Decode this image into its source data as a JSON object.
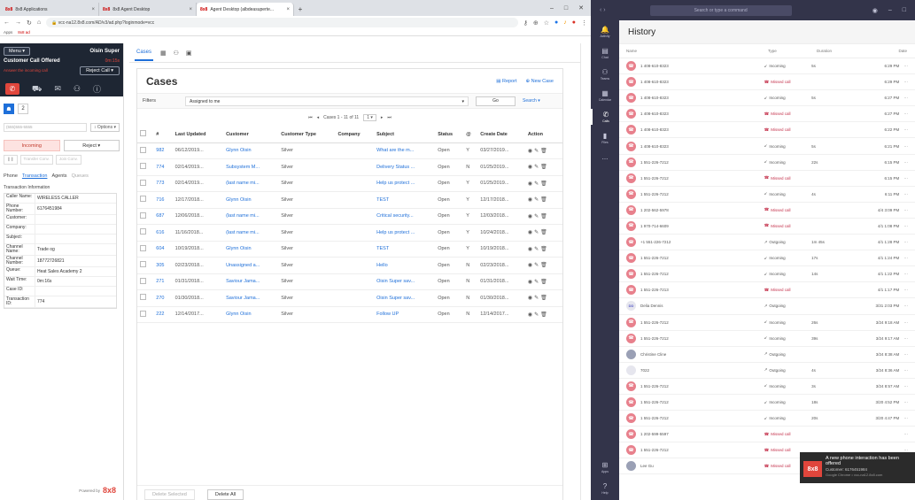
{
  "browser": {
    "tabs": [
      {
        "label": "8x8 Applications",
        "fav": "8x8"
      },
      {
        "label": "8x8 Agent Desktop",
        "fav": "8x8"
      },
      {
        "label": "Agent Desktop (albdeasuperte... ",
        "fav": "8x8"
      }
    ],
    "url": "vcc-na12.8x8.com/AD/v3/ad.php?loginmode=vcc",
    "bookmarks": [
      "Apps",
      "8x8 ad"
    ],
    "win_controls": [
      "–",
      "□",
      "✕"
    ]
  },
  "agent": {
    "menu_label": "Menu",
    "agent_name": "Oisin Super",
    "status": "Customer Call Offered",
    "timer": "0m:15s",
    "warning": "Answer the incoming call",
    "reject_call_label": "Reject Call",
    "search_placeholder": "(555)555-5555",
    "options_label": "Options",
    "incoming_label": "Incoming",
    "reject_label": "Reject",
    "call_ops": [
      "Transfer Conv.",
      "Join Conv."
    ],
    "tabs": [
      "Phone",
      "Transaction",
      "Agents",
      "Queues"
    ],
    "info_title": "Transaction Information",
    "info": [
      {
        "k": "Caller Name:",
        "v": "WIRELESS CALLER"
      },
      {
        "k": "Phone Number:",
        "v": "6176451984"
      },
      {
        "k": "Customer:",
        "v": ""
      },
      {
        "k": "Company:",
        "v": ""
      },
      {
        "k": "Subject:",
        "v": ""
      },
      {
        "k": "Channel Name:",
        "v": "Trade og"
      },
      {
        "k": "Channel Number:",
        "v": "18772726821"
      },
      {
        "k": "Queue:",
        "v": "Heat Sales Academy 2"
      },
      {
        "k": "Wait Time:",
        "v": "0m:16s"
      },
      {
        "k": "Case ID:",
        "v": ""
      },
      {
        "k": "Transaction ID:",
        "v": "774"
      }
    ],
    "powered_by": "Powered by",
    "brand": "8x8"
  },
  "cases": {
    "tab_label": "Cases",
    "title": "Cases",
    "report_label": "Report",
    "new_case_label": "New Case",
    "filters_label": "Filters",
    "filter_value": "Assigned to me",
    "go_label": "Go",
    "search_label": "Search",
    "pager_text": "Cases 1 - 11 of 11",
    "page_size": "1",
    "columns": [
      "#",
      "Last Updated",
      "Customer",
      "Customer Type",
      "Company",
      "Subject",
      "Status",
      "@",
      "Create Date",
      "Action"
    ],
    "rows": [
      {
        "id": "982",
        "updated": "06/12/2019...",
        "customer": "Glynn Oisin",
        "ctype": "Silver",
        "company": "",
        "subject": "What are the m...",
        "status": "Open",
        "flag": "Y",
        "created": "03/27/2019..."
      },
      {
        "id": "774",
        "updated": "02/14/2019...",
        "customer": "Subsystem M...",
        "ctype": "Silver",
        "company": "",
        "subject": "Delivery Status ...",
        "status": "Open",
        "flag": "N",
        "created": "01/25/2019..."
      },
      {
        "id": "773",
        "updated": "02/14/2019...",
        "customer": "(last name mi...",
        "ctype": "Silver",
        "company": "",
        "subject": "Help us protect ...",
        "status": "Open",
        "flag": "Y",
        "created": "01/25/2019..."
      },
      {
        "id": "716",
        "updated": "12/17/2018...",
        "customer": "Glynn Oisin",
        "ctype": "Silver",
        "company": "",
        "subject": "TEST",
        "status": "Open",
        "flag": "Y",
        "created": "12/17/2018..."
      },
      {
        "id": "687",
        "updated": "12/06/2018...",
        "customer": "(last name mi...",
        "ctype": "Silver",
        "company": "",
        "subject": "Critical security...",
        "status": "Open",
        "flag": "Y",
        "created": "12/03/2018..."
      },
      {
        "id": "616",
        "updated": "11/16/2018...",
        "customer": "(last name mi...",
        "ctype": "Silver",
        "company": "",
        "subject": "Help us protect ...",
        "status": "Open",
        "flag": "Y",
        "created": "10/24/2018..."
      },
      {
        "id": "604",
        "updated": "10/19/2018...",
        "customer": "Glynn Oisin",
        "ctype": "Silver",
        "company": "",
        "subject": "TEST",
        "status": "Open",
        "flag": "Y",
        "created": "10/19/2018..."
      },
      {
        "id": "305",
        "updated": "02/23/2018...",
        "customer": "Unassigned a...",
        "ctype": "Silver",
        "company": "",
        "subject": "Hello",
        "status": "Open",
        "flag": "N",
        "created": "02/23/2018..."
      },
      {
        "id": "271",
        "updated": "01/31/2018...",
        "customer": "Saviour Jama...",
        "ctype": "Silver",
        "company": "",
        "subject": "Oisin Super sav...",
        "status": "Open",
        "flag": "N",
        "created": "01/31/2018..."
      },
      {
        "id": "270",
        "updated": "01/30/2018...",
        "customer": "Saviour Jama...",
        "ctype": "Silver",
        "company": "",
        "subject": "Oisin Super sav...",
        "status": "Open",
        "flag": "N",
        "created": "01/30/2018..."
      },
      {
        "id": "222",
        "updated": "12/14/2017...",
        "customer": "Glynn Oisin",
        "ctype": "Silver",
        "company": "",
        "subject": "Follow UP",
        "status": "Open",
        "flag": "N",
        "created": "12/14/2017..."
      }
    ],
    "delete_selected_label": "Delete Selected",
    "delete_all_label": "Delete All"
  },
  "teams": {
    "search_placeholder": "Search or type a command",
    "rail": [
      "Activity",
      "Chat",
      "Teams",
      "Calendar",
      "Calls",
      "Files",
      "..."
    ],
    "rail_bottom": [
      "Apps",
      "Help"
    ],
    "title": "History",
    "columns": {
      "name": "Name",
      "type": "Type",
      "duration": "Duration",
      "date": "Date"
    },
    "rows": [
      {
        "name": "1 408-610-8323",
        "type": "Incoming",
        "dur": "5s",
        "date": "6:29 PM",
        "av": ""
      },
      {
        "name": "1 408-610-8323",
        "type": "Missed call",
        "dur": "",
        "date": "6:29 PM",
        "av": ""
      },
      {
        "name": "1 408-610-8323",
        "type": "Incoming",
        "dur": "5s",
        "date": "6:27 PM",
        "av": ""
      },
      {
        "name": "1 408-610-8323",
        "type": "Missed call",
        "dur": "",
        "date": "6:27 PM",
        "av": ""
      },
      {
        "name": "1 408-610-8323",
        "type": "Missed call",
        "dur": "",
        "date": "6:22 PM",
        "av": ""
      },
      {
        "name": "1 408-610-8323",
        "type": "Incoming",
        "dur": "5s",
        "date": "6:21 PM",
        "av": ""
      },
      {
        "name": "1 551-226-7212",
        "type": "Incoming",
        "dur": "22s",
        "date": "6:15 PM",
        "av": ""
      },
      {
        "name": "1 551-226-7212",
        "type": "Missed call",
        "dur": "",
        "date": "6:15 PM",
        "av": ""
      },
      {
        "name": "1 551-226-7212",
        "type": "Incoming",
        "dur": "4s",
        "date": "6:11 PM",
        "av": ""
      },
      {
        "name": "1 202-562-5978",
        "type": "Missed call",
        "dur": "",
        "date": "4/4 3:09 PM",
        "av": ""
      },
      {
        "name": "1 970-714-6609",
        "type": "Missed call",
        "dur": "",
        "date": "4/1 1:08 PM",
        "av": ""
      },
      {
        "name": "+1 551-226-7212",
        "type": "Outgoing",
        "dur": "1m 45s",
        "date": "4/1 1:28 PM",
        "av": ""
      },
      {
        "name": "1 551-226-7212",
        "type": "Incoming",
        "dur": "17s",
        "date": "4/1 1:24 PM",
        "av": ""
      },
      {
        "name": "1 551-226-7212",
        "type": "Incoming",
        "dur": "14s",
        "date": "4/1 1:22 PM",
        "av": ""
      },
      {
        "name": "1 551-226-7213",
        "type": "Missed call",
        "dur": "",
        "date": "4/1 1:17 PM",
        "av": ""
      },
      {
        "name": "Delia Dennis",
        "type": "Outgoing",
        "dur": "",
        "date": "3/31 2:03 PM",
        "av": "DD"
      },
      {
        "name": "1 551-226-7212",
        "type": "Incoming",
        "dur": "26s",
        "date": "3/24 9:18 AM",
        "av": ""
      },
      {
        "name": "1 551-226-7212",
        "type": "Incoming",
        "dur": "39s",
        "date": "3/24 9:17 AM",
        "av": ""
      },
      {
        "name": "Christine Cline",
        "type": "Outgoing",
        "dur": "",
        "date": "3/24 8:38 AM",
        "av": "photo"
      },
      {
        "name": "7022",
        "type": "Outgoing",
        "dur": "4s",
        "date": "3/24 8:36 AM",
        "av": "grey"
      },
      {
        "name": "1 551-226-7212",
        "type": "Incoming",
        "dur": "3s",
        "date": "3/24 8:57 AM",
        "av": ""
      },
      {
        "name": "1 551-226-7212",
        "type": "Incoming",
        "dur": "18s",
        "date": "3/20 4:52 PM",
        "av": ""
      },
      {
        "name": "1 551-226-7212",
        "type": "Incoming",
        "dur": "20s",
        "date": "3/20 4:47 PM",
        "av": ""
      },
      {
        "name": "1 202-599-5597",
        "type": "Missed call",
        "dur": "",
        "date": "",
        "av": ""
      },
      {
        "name": "1 551-226-7212",
        "type": "Missed call",
        "dur": "",
        "date": "",
        "av": ""
      },
      {
        "name": "Lee Gu",
        "type": "Missed call",
        "dur": "",
        "date": "",
        "av": "photo"
      }
    ]
  },
  "toast": {
    "title": "A new phone interaction has been offered",
    "line2": "Customer: 6176451984",
    "line3": "Google Chrome • vcc-na12.8x8.com",
    "brand": "8x8"
  },
  "colors": {
    "brand_red": "#e0463c",
    "link_blue": "#1e6fd9",
    "teams_dark": "#33344a",
    "missed_red": "#c4314b"
  }
}
